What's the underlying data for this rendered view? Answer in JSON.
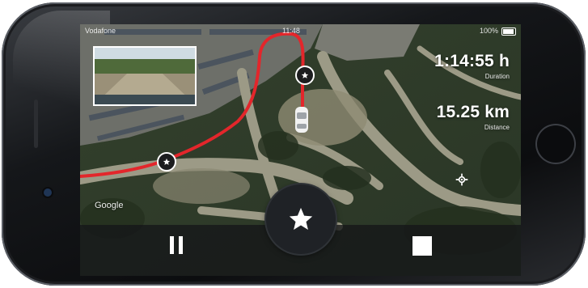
{
  "status_bar": {
    "left": "Vodafone",
    "time": "11:48",
    "battery": "100%"
  },
  "stats": {
    "duration": {
      "value": "1:14:55 h",
      "label": "Duration"
    },
    "distance": {
      "value": "15.25 km",
      "label": "Distance"
    }
  },
  "map": {
    "attribution": "Google",
    "route_color": "#e3262b"
  },
  "controls": {
    "pause_icon": "pause-icon",
    "record_icon": "star-icon",
    "stop_icon": "stop-icon",
    "locate_icon": "crosshair-icon"
  },
  "colors": {
    "accent": "#e3262b",
    "control_bar": "#141618",
    "text": "#ffffff"
  }
}
